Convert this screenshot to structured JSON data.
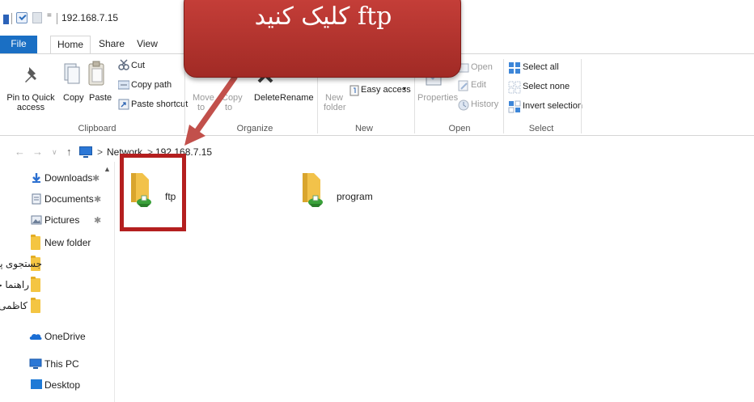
{
  "window": {
    "title": "192.168.7.15"
  },
  "quick_access_toolbar": {
    "dropdown_glyph": "="
  },
  "ribbon_tabs": [
    "File",
    "Home",
    "Share",
    "View"
  ],
  "ribbon": {
    "clipboard": {
      "pin_label": "Pin to Quick access",
      "pin_line1": "Pin to Quick",
      "pin_line2": "access",
      "copy": "Copy",
      "paste": "Paste",
      "cut": "Cut",
      "copy_path": "Copy path",
      "paste_shortcut": "Paste shortcut",
      "group": "Clipboard"
    },
    "organize": {
      "move_to_1": "Move",
      "move_to_2": "to",
      "copy_to_1": "Copy",
      "copy_to_2": "to",
      "delete": "Delete",
      "rename": "Rename",
      "group": "Organize"
    },
    "new": {
      "new_folder_1": "New",
      "new_folder_2": "folder",
      "easy_access": "Easy access",
      "group": "New"
    },
    "open": {
      "properties": "Properties",
      "open": "Open",
      "edit": "Edit",
      "history": "History",
      "group": "Open"
    },
    "select": {
      "select_all": "Select all",
      "select_none": "Select none",
      "invert": "Invert selection",
      "group": "Select"
    }
  },
  "address_bar": {
    "segments": [
      "Network",
      "192.168.7.15"
    ],
    "separator": ">"
  },
  "nav_pane": {
    "quick_access": [
      {
        "label": "Downloads",
        "icon": "download-icon",
        "pinned": true
      },
      {
        "label": "Documents",
        "icon": "document-icon",
        "pinned": true
      },
      {
        "label": "Pictures",
        "icon": "pictures-icon",
        "pinned": true
      },
      {
        "label": "New folder",
        "icon": "folder-icon",
        "pinned": false
      },
      {
        "label": "جستجوی پایان نامه",
        "icon": "folder-icon",
        "pinned": false
      },
      {
        "label": "راهنما جستجو",
        "icon": "folder-icon",
        "pinned": false
      },
      {
        "label": "کاظمی",
        "icon": "folder-icon",
        "pinned": false
      }
    ],
    "onedrive": "OneDrive",
    "this_pc": "This PC",
    "desktop": "Desktop"
  },
  "content": {
    "items": [
      {
        "name": "ftp",
        "type": "network-share"
      },
      {
        "name": "program",
        "type": "network-share"
      }
    ]
  },
  "annotation": {
    "callout_text": "ftp کلیک کنید",
    "colors": {
      "callout": "#b83430",
      "highlight": "#b41f1f",
      "arrow": "#c2504b"
    }
  },
  "colors": {
    "file_tab": "#1a6fc4",
    "folder": "#f4c542",
    "share_badge": "#3aa13a"
  }
}
